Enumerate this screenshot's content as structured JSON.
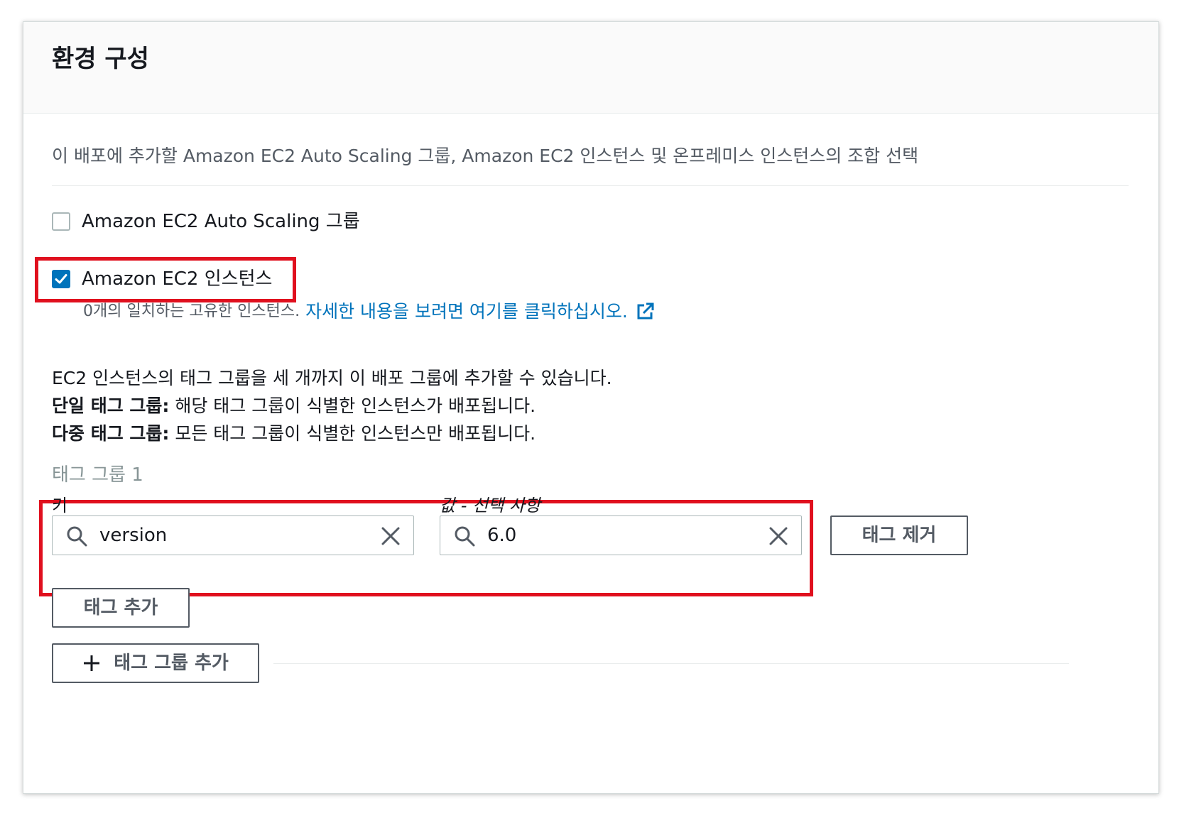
{
  "panel": {
    "title": "환경 구성",
    "description": "이 배포에 추가할 Amazon EC2 Auto Scaling 그룹, Amazon EC2 인스턴스 및 온프레미스 인스턴스의 조합 선택"
  },
  "options": {
    "asg_label": "Amazon EC2 Auto Scaling 그룹",
    "asg_checked": false,
    "ec2_label": "Amazon EC2 인스턴스",
    "ec2_checked": true,
    "match_text": "0개의 일치하는 고유한 인스턴스.",
    "details_link": "자세한 내용을 보려면 여기를 클릭하십시오."
  },
  "help": {
    "line1": "EC2 인스턴스의 태그 그룹을 세 개까지 이 배포 그룹에 추가할 수 있습니다.",
    "single_label": "단일 태그 그룹:",
    "single_text": " 해당 태그 그룹이 식별한 인스턴스가 배포됩니다.",
    "multi_label": "다중 태그 그룹:",
    "multi_text": " 모든 태그 그룹이 식별한 인스턴스만 배포됩니다."
  },
  "tag_group": {
    "title": "태그 그룹 1",
    "key_label": "키",
    "value_label": "값 - 선택 사항",
    "key_value": "version",
    "value_value": "6.0",
    "remove_label": "태그 제거",
    "add_tag_label": "태그 추가",
    "add_group_label": "태그 그룹 추가"
  },
  "colors": {
    "accent": "#0073bb",
    "highlight": "#e0101e",
    "muted": "#545b64"
  },
  "icons": [
    "checkmark-icon",
    "external-link-icon",
    "search-icon",
    "close-icon",
    "plus-icon"
  ]
}
